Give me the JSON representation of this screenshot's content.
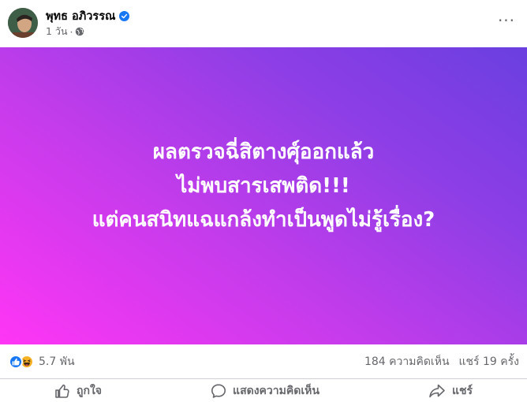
{
  "header": {
    "author_name": "พุทธ อภิวรรณ",
    "timestamp": "1 วัน",
    "separator": "·",
    "verified_icon": "verified-badge-icon",
    "privacy_icon": "globe-icon",
    "more_label": "···"
  },
  "banner": {
    "lines": [
      "ผลตรวจฉี่สิตางศุ์ออกแล้ว",
      "ไม่พบสารเสพติด!!!",
      "แต่คนสนิทแฉแกล้งทำเป็นพูดไม่รู้เรื่อง?"
    ],
    "gradient_colors": [
      "#ff35f5",
      "#c23ceb",
      "#8f3ee6",
      "#6a3fe0"
    ],
    "text_color": "#ffffff"
  },
  "stats": {
    "reaction_icons": [
      "like-reaction-icon",
      "haha-reaction-icon"
    ],
    "reaction_count": "5.7 พัน",
    "comments": "184 ความคิดเห็น",
    "shares": "แชร์ 19 ครั้ง"
  },
  "actions": {
    "like_label": "ถูกใจ",
    "comment_label": "แสดงความคิดเห็น",
    "share_label": "แชร์"
  },
  "colors": {
    "accent": "#1877f2",
    "secondary_text": "#65676b",
    "divider": "#ced0d4"
  }
}
